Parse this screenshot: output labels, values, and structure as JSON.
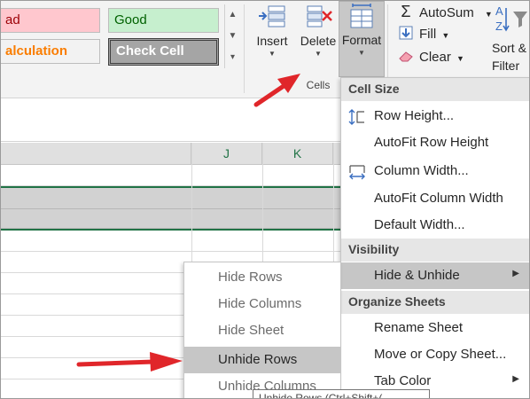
{
  "ribbon": {
    "styles": {
      "bad": "ad",
      "good": "Good",
      "calculation": "alculation",
      "check_cell": "Check Cell"
    },
    "cells_group": {
      "insert_label": "Insert",
      "delete_label": "Delete",
      "format_label": "Format",
      "group_label": "Cells"
    },
    "editing_group": {
      "autosum_label": "AutoSum",
      "fill_label": "Fill",
      "clear_label": "Clear",
      "sort_label_line1": "Sort &",
      "sort_label_line2": "Filter"
    }
  },
  "grid": {
    "column_headers": [
      "J",
      "K"
    ]
  },
  "format_menu": {
    "sections": {
      "cell_size": "Cell Size",
      "visibility": "Visibility",
      "organize_sheets": "Organize Sheets"
    },
    "items": {
      "row_height": "Row Height...",
      "autofit_row_height": "AutoFit Row Height",
      "column_width": "Column Width...",
      "autofit_column_width": "AutoFit Column Width",
      "default_width": "Default Width...",
      "hide_unhide": "Hide & Unhide",
      "rename_sheet": "Rename Sheet",
      "move_copy_sheet": "Move or Copy Sheet...",
      "tab_color": "Tab Color"
    }
  },
  "hide_unhide_submenu": {
    "items": {
      "hide_rows": "Hide Rows",
      "hide_columns": "Hide Columns",
      "hide_sheet": "Hide Sheet",
      "unhide_rows": "Unhide Rows",
      "unhide_columns": "Unhide Columns"
    }
  },
  "tooltip": "Unhide Rows (Ctrl+Shift+(",
  "colors": {
    "accent_green": "#217346",
    "annotation_arrow": "#e0262a",
    "format_button_active": "#c8c8c8"
  },
  "icons": {
    "insert": "insert-cells-icon",
    "delete": "delete-cells-icon",
    "format": "format-cells-icon",
    "autosum": "sigma-icon",
    "fill": "fill-down-icon",
    "clear": "eraser-icon",
    "sort_filter": "sort-filter-icon",
    "row_height": "row-height-icon",
    "column_width": "column-width-icon"
  }
}
